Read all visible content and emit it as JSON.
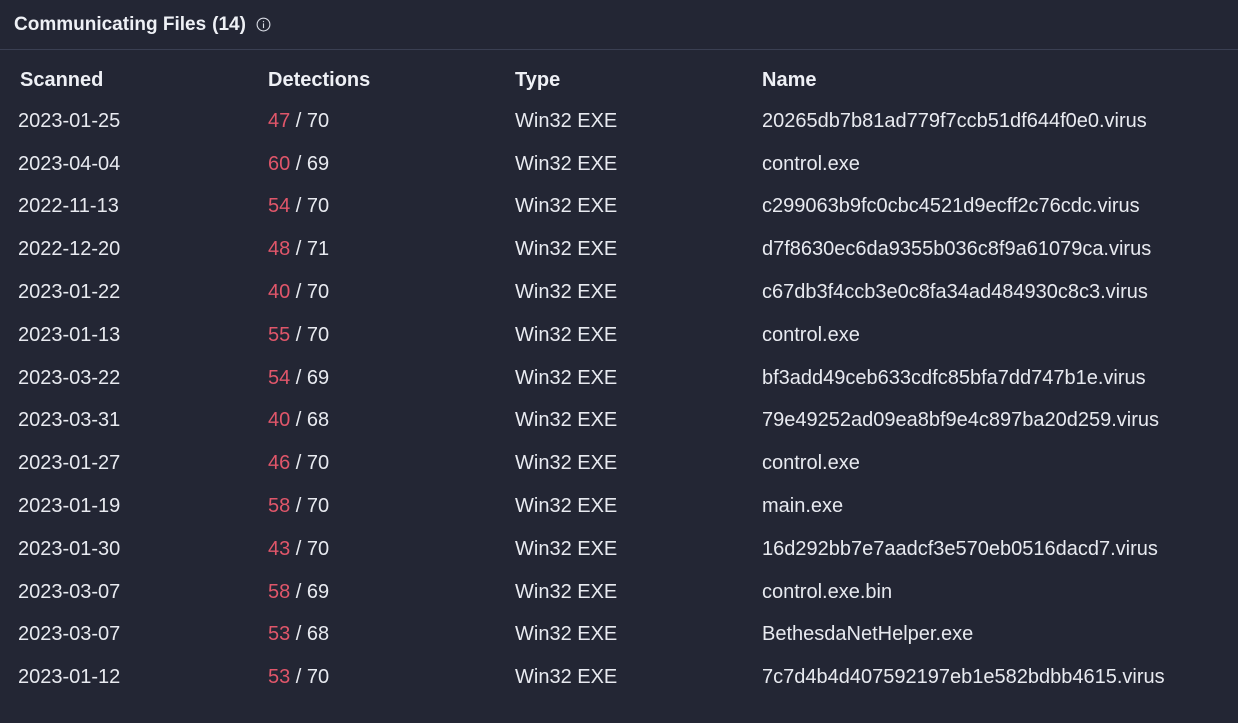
{
  "panel": {
    "title": "Communicating Files",
    "count": "(14)",
    "info_icon": "info-circle-icon"
  },
  "colors": {
    "background": "#232634",
    "detection_positive": "#e0566a",
    "text": "#e8eaf0"
  },
  "table": {
    "headers": {
      "scanned": "Scanned",
      "detections": "Detections",
      "type": "Type",
      "name": "Name"
    },
    "rows": [
      {
        "scanned": "2023-01-25",
        "positives": "47",
        "total": " / 70",
        "type": "Win32 EXE",
        "name": "20265db7b81ad779f7ccb51df644f0e0.virus"
      },
      {
        "scanned": "2023-04-04",
        "positives": "60",
        "total": " / 69",
        "type": "Win32 EXE",
        "name": "control.exe"
      },
      {
        "scanned": "2022-11-13",
        "positives": "54",
        "total": " / 70",
        "type": "Win32 EXE",
        "name": "c299063b9fc0cbc4521d9ecff2c76cdc.virus"
      },
      {
        "scanned": "2022-12-20",
        "positives": "48",
        "total": " / 71",
        "type": "Win32 EXE",
        "name": "d7f8630ec6da9355b036c8f9a61079ca.virus"
      },
      {
        "scanned": "2023-01-22",
        "positives": "40",
        "total": " / 70",
        "type": "Win32 EXE",
        "name": "c67db3f4ccb3e0c8fa34ad484930c8c3.virus"
      },
      {
        "scanned": "2023-01-13",
        "positives": "55",
        "total": " / 70",
        "type": "Win32 EXE",
        "name": "control.exe"
      },
      {
        "scanned": "2023-03-22",
        "positives": "54",
        "total": " / 69",
        "type": "Win32 EXE",
        "name": "bf3add49ceb633cdfc85bfa7dd747b1e.virus"
      },
      {
        "scanned": "2023-03-31",
        "positives": "40",
        "total": " / 68",
        "type": "Win32 EXE",
        "name": "79e49252ad09ea8bf9e4c897ba20d259.virus"
      },
      {
        "scanned": "2023-01-27",
        "positives": "46",
        "total": " / 70",
        "type": "Win32 EXE",
        "name": "control.exe"
      },
      {
        "scanned": "2023-01-19",
        "positives": "58",
        "total": " / 70",
        "type": "Win32 EXE",
        "name": "main.exe"
      },
      {
        "scanned": "2023-01-30",
        "positives": "43",
        "total": " / 70",
        "type": "Win32 EXE",
        "name": "16d292bb7e7aadcf3e570eb0516dacd7.virus"
      },
      {
        "scanned": "2023-03-07",
        "positives": "58",
        "total": " / 69",
        "type": "Win32 EXE",
        "name": "control.exe.bin"
      },
      {
        "scanned": "2023-03-07",
        "positives": "53",
        "total": " / 68",
        "type": "Win32 EXE",
        "name": "BethesdaNetHelper.exe"
      },
      {
        "scanned": "2023-01-12",
        "positives": "53",
        "total": " / 70",
        "type": "Win32 EXE",
        "name": "7c7d4b4d407592197eb1e582bdbb4615.virus"
      }
    ]
  }
}
